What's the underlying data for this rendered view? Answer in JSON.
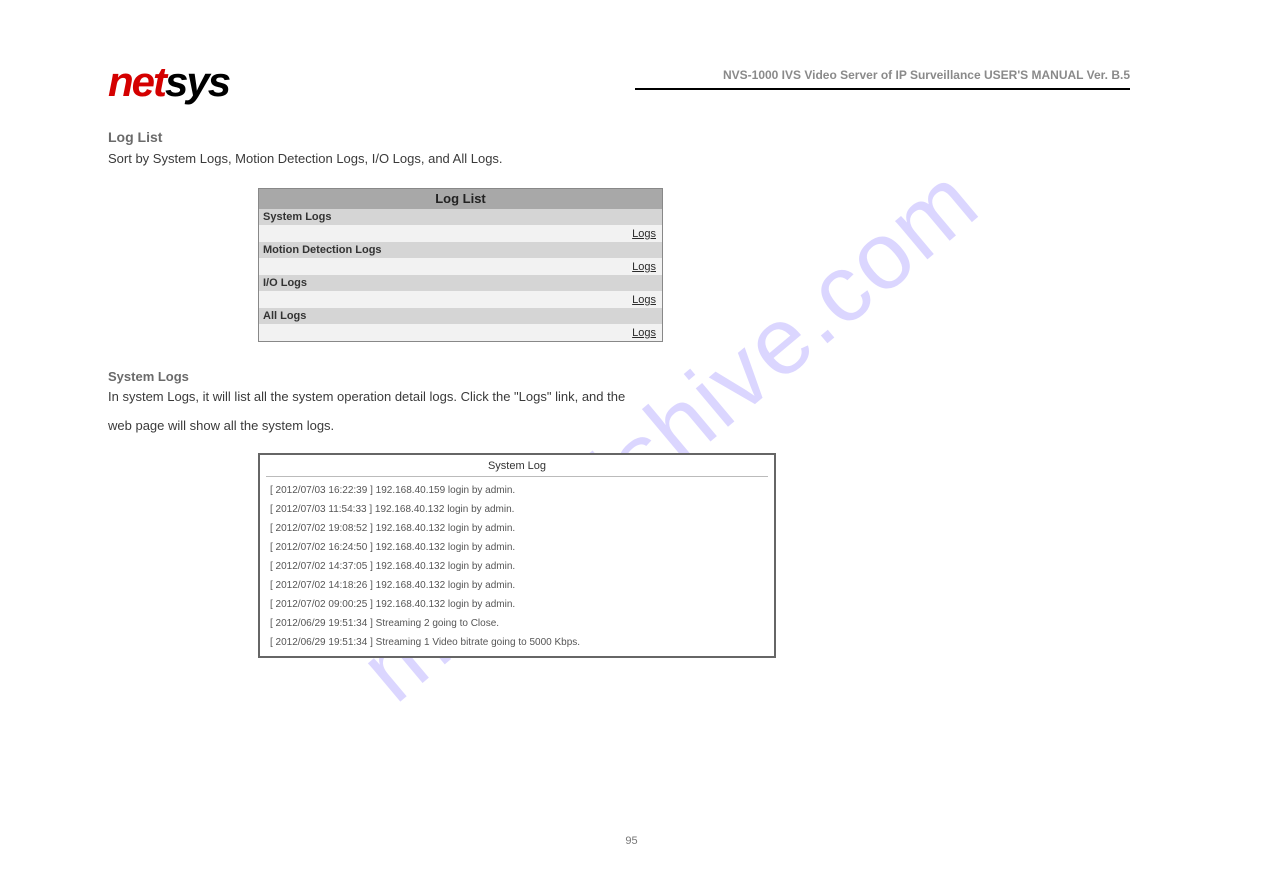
{
  "brand": {
    "net": "net",
    "sys": "sys"
  },
  "manual_title": "NVS-1000 IVS Video Server of IP Surveillance  USER'S  MANUAL  Ver. B.5",
  "section": {
    "heading": "Log List",
    "intro": "Sort by System Logs, Motion Detection Logs, I/O Logs, and All Logs."
  },
  "loglist": {
    "title": "Log List",
    "categories": [
      {
        "name": "System Logs",
        "link": "Logs"
      },
      {
        "name": "Motion Detection Logs",
        "link": "Logs"
      },
      {
        "name": "I/O Logs",
        "link": "Logs"
      },
      {
        "name": "All Logs",
        "link": "Logs"
      }
    ]
  },
  "subsection": {
    "heading": "System Logs",
    "text": "In system Logs, it will list all the system operation detail logs. Click the \"Logs\" link, and the",
    "text2": "web page will show all the system logs."
  },
  "syslog": {
    "title": "System Log",
    "lines": [
      "[ 2012/07/03 16:22:39 ] 192.168.40.159 login by admin.",
      "[ 2012/07/03 11:54:33 ] 192.168.40.132 login by admin.",
      "[ 2012/07/02 19:08:52 ] 192.168.40.132 login by admin.",
      "[ 2012/07/02 16:24:50 ] 192.168.40.132 login by admin.",
      "[ 2012/07/02 14:37:05 ] 192.168.40.132 login by admin.",
      "[ 2012/07/02 14:18:26 ] 192.168.40.132 login by admin.",
      "[ 2012/07/02 09:00:25 ] 192.168.40.132 login by admin.",
      "[ 2012/06/29 19:51:34 ] Streaming 2 going to Close.",
      "[ 2012/06/29 19:51:34 ] Streaming 1 Video bitrate going to 5000 Kbps."
    ]
  },
  "page_number": "95",
  "watermark": "manualshive.com"
}
